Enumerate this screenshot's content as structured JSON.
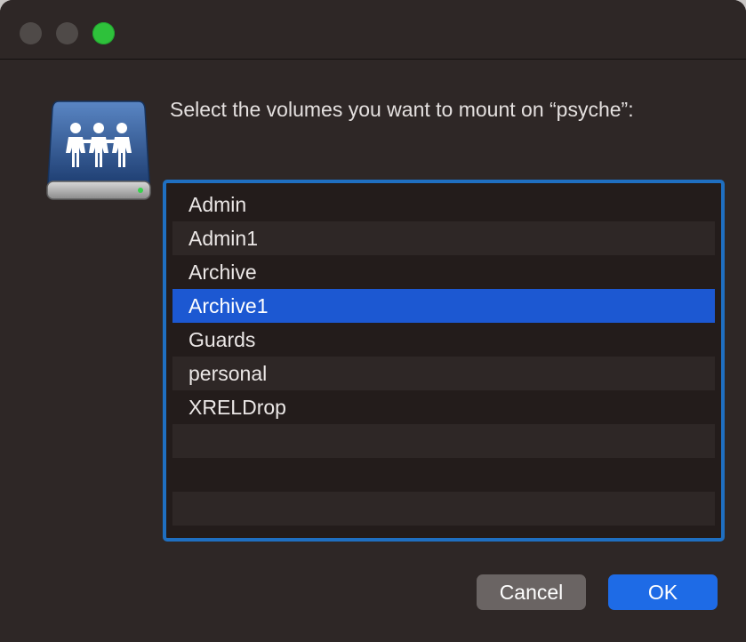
{
  "dialog": {
    "prompt": "Select the volumes you want to mount on “psyche”:",
    "volumes": [
      {
        "label": "Admin"
      },
      {
        "label": "Admin1"
      },
      {
        "label": "Archive"
      },
      {
        "label": "Archive1",
        "selected": true
      },
      {
        "label": "Guards"
      },
      {
        "label": "personal"
      },
      {
        "label": "XRELDrop"
      }
    ],
    "cancel_label": "Cancel",
    "ok_label": "OK"
  },
  "icons": {
    "drive": "shared-network-drive-icon"
  },
  "colors": {
    "selection": "#1c58d2",
    "focus_ring": "#1f6fc1",
    "ok_button": "#1e6be6",
    "zoom_button": "#2ec13b"
  }
}
